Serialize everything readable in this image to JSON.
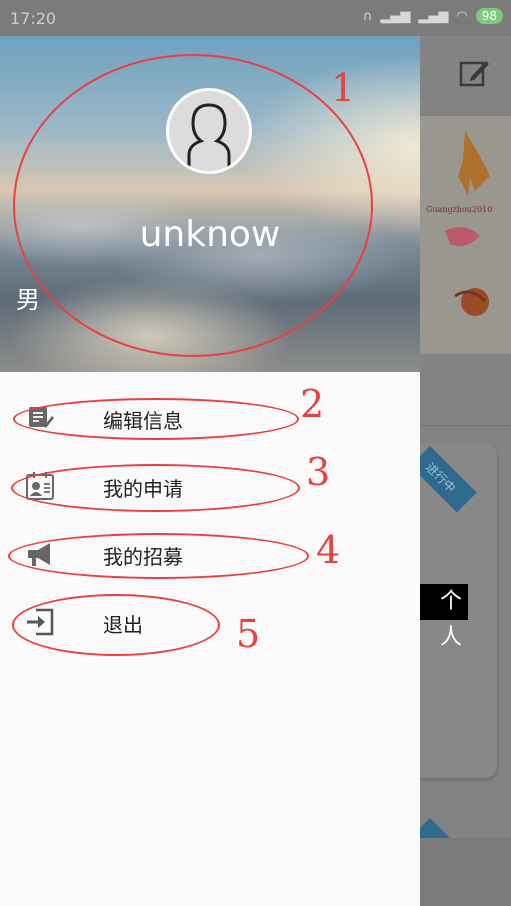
{
  "statusbar": {
    "time": "17:20",
    "battery": "98"
  },
  "background_app": {
    "ribbon_text": "进行中",
    "partial_text": "个人",
    "banner_caption": "Guangzhou2010"
  },
  "drawer": {
    "username": "unknow",
    "gender": "男",
    "menu": [
      {
        "label": "编辑信息",
        "icon": "edit-info-icon"
      },
      {
        "label": "我的申请",
        "icon": "id-card-icon"
      },
      {
        "label": "我的招募",
        "icon": "megaphone-icon"
      },
      {
        "label": "退出",
        "icon": "logout-icon"
      }
    ]
  },
  "annotations": [
    "1",
    "2",
    "3",
    "4",
    "5"
  ],
  "colors": {
    "annotation": "#e84141",
    "drawer_bg": "#fafafa",
    "overlay": "#808080",
    "ribbon": "#2e6a8d"
  }
}
